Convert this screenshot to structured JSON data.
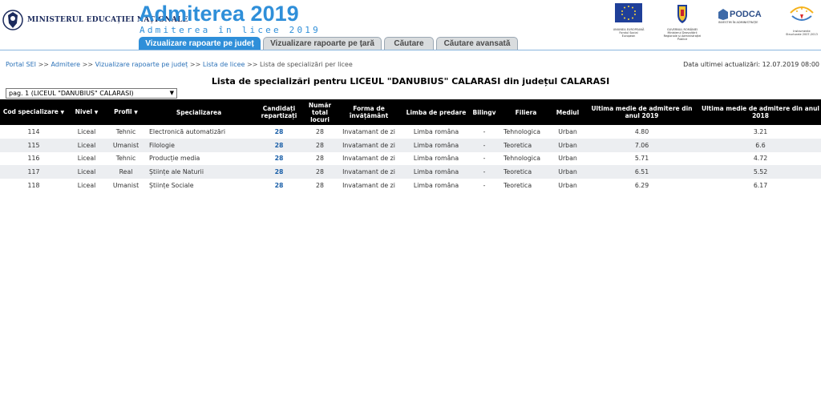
{
  "header": {
    "ministry": "MINISTERUL EDUCAȚIEI NAȚIONALE",
    "title": "Admiterea 2019",
    "subtitle": "Admiterea în licee 2019",
    "logos": [
      {
        "name": "eu-flag",
        "caption": "UNIUNEA EUROPEANĂ Fondul Social European"
      },
      {
        "name": "ro-crest",
        "caption": "GUVERNUL ROMÂNIEI Ministerul Dezvoltării Regionale și Administrației Publice"
      },
      {
        "name": "podca",
        "text": "PODCA",
        "caption": "INVESTIM ÎN ADMINISTRAȚIE"
      },
      {
        "name": "instrumente-structurale",
        "caption": "Instrumente Structurale 2007-2013"
      }
    ]
  },
  "tabs": [
    {
      "label": "Vizualizare rapoarte pe județ",
      "active": true
    },
    {
      "label": "Vizualizare rapoarte pe țară",
      "active": false
    },
    {
      "label": "Căutare",
      "active": false
    },
    {
      "label": "Căutare avansată",
      "active": false
    }
  ],
  "breadcrumb": {
    "items": [
      "Portal SEI",
      "Admitere",
      "Vizualizare rapoarte pe județ",
      "Lista de licee"
    ],
    "current": "Lista de specializări per licee",
    "separator": ">>"
  },
  "last_update": "Data ultimei actualizări: 12.07.2019 08:00",
  "page_title": "Lista de specializări pentru LICEUL \"DANUBIUS\" CALARASI din județul CALARASI",
  "page_select": "pag. 1 (LICEUL \"DANUBIUS\" CALARASI)",
  "table": {
    "columns": [
      {
        "key": "cod",
        "label": "Cod specializare",
        "sortable": true
      },
      {
        "key": "nivel",
        "label": "Nivel",
        "sortable": true
      },
      {
        "key": "profil",
        "label": "Profil",
        "sortable": true
      },
      {
        "key": "specializare",
        "label": "Specializarea",
        "sortable": false
      },
      {
        "key": "candidati",
        "label": "Candidați repartizați",
        "sortable": false
      },
      {
        "key": "locuri",
        "label": "Număr total locuri",
        "sortable": false
      },
      {
        "key": "forma",
        "label": "Forma de învățământ",
        "sortable": false
      },
      {
        "key": "limba",
        "label": "Limba de predare",
        "sortable": false
      },
      {
        "key": "bilingv",
        "label": "Bilingv",
        "sortable": false
      },
      {
        "key": "filiera",
        "label": "Filiera",
        "sortable": false
      },
      {
        "key": "mediul",
        "label": "Mediul",
        "sortable": false
      },
      {
        "key": "m2019",
        "label": "Ultima medie de admitere din anul 2019",
        "sortable": false
      },
      {
        "key": "m2018",
        "label": "Ultima medie de admitere din anul 2018",
        "sortable": false
      }
    ],
    "rows": [
      {
        "cod": "114",
        "nivel": "Liceal",
        "profil": "Tehnic",
        "specializare": "Electronică automatizări",
        "candidati": "28",
        "locuri": "28",
        "forma": "Invatamant de zi",
        "limba": "Limba româna",
        "bilingv": "-",
        "filiera": "Tehnologica",
        "mediul": "Urban",
        "m2019": "4.80",
        "m2018": "3.21"
      },
      {
        "cod": "115",
        "nivel": "Liceal",
        "profil": "Umanist",
        "specializare": "Filologie",
        "candidati": "28",
        "locuri": "28",
        "forma": "Invatamant de zi",
        "limba": "Limba româna",
        "bilingv": "-",
        "filiera": "Teoretica",
        "mediul": "Urban",
        "m2019": "7.06",
        "m2018": "6.6"
      },
      {
        "cod": "116",
        "nivel": "Liceal",
        "profil": "Tehnic",
        "specializare": "Producție media",
        "candidati": "28",
        "locuri": "28",
        "forma": "Invatamant de zi",
        "limba": "Limba româna",
        "bilingv": "-",
        "filiera": "Tehnologica",
        "mediul": "Urban",
        "m2019": "5.71",
        "m2018": "4.72"
      },
      {
        "cod": "117",
        "nivel": "Liceal",
        "profil": "Real",
        "specializare": "Științe ale Naturii",
        "candidati": "28",
        "locuri": "28",
        "forma": "Invatamant de zi",
        "limba": "Limba româna",
        "bilingv": "-",
        "filiera": "Teoretica",
        "mediul": "Urban",
        "m2019": "6.51",
        "m2018": "5.52"
      },
      {
        "cod": "118",
        "nivel": "Liceal",
        "profil": "Umanist",
        "specializare": "Științe Sociale",
        "candidati": "28",
        "locuri": "28",
        "forma": "Invatamant de zi",
        "limba": "Limba româna",
        "bilingv": "-",
        "filiera": "Teoretica",
        "mediul": "Urban",
        "m2019": "6.29",
        "m2018": "6.17"
      }
    ]
  },
  "colors": {
    "accent": "#2f8fd9",
    "header_bg": "#000000",
    "link": "#1a5fa8",
    "row_alt": "#eceef1"
  }
}
